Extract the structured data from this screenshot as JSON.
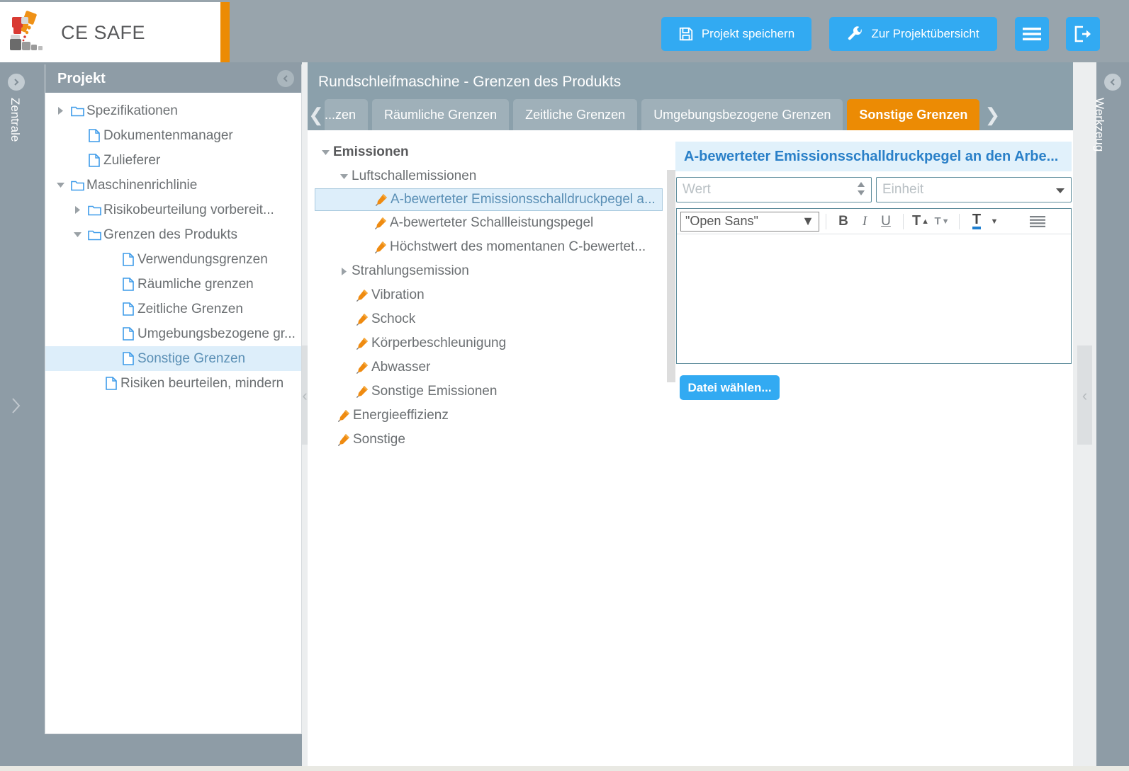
{
  "brand": {
    "name": "CE SAFE",
    "accent": "#ec8b04",
    "blue": "#32aaf2"
  },
  "topbar": {
    "save_label": "Projekt speichern",
    "overview_label": "Zur Projektübersicht",
    "menu_label": "",
    "logout_label": ""
  },
  "left_rail": {
    "label": "Zentrale",
    "icon": "chevron-right-circle-icon"
  },
  "right_rail": {
    "label": "Werkzeug",
    "icon": "chevron-left-circle-icon"
  },
  "project_panel": {
    "title": "Projekt",
    "collapse_icon": "chevron-left-circle-icon",
    "tree": [
      {
        "label": "Spezifikationen",
        "icon": "folder-icon",
        "twisty": "collapsed",
        "indent": 0,
        "selected": false
      },
      {
        "label": "Dokumentenmanager",
        "icon": "file-icon",
        "twisty": "none",
        "indent": 1,
        "selected": false
      },
      {
        "label": "Zulieferer",
        "icon": "file-icon",
        "twisty": "none",
        "indent": 1,
        "selected": false
      },
      {
        "label": "Maschinenrichlinie",
        "icon": "folder-icon",
        "twisty": "expanded",
        "indent": 0,
        "selected": false
      },
      {
        "label": "Risikobeurteilung vorbereit...",
        "icon": "folder-icon",
        "twisty": "collapsed",
        "indent": 1,
        "selected": false
      },
      {
        "label": "Grenzen des Produkts",
        "icon": "folder-icon",
        "twisty": "expanded",
        "indent": 1,
        "selected": false
      },
      {
        "label": "Verwendungsgrenzen",
        "icon": "file-icon",
        "twisty": "none",
        "indent": 3,
        "selected": false
      },
      {
        "label": "Räumliche grenzen",
        "icon": "file-icon",
        "twisty": "none",
        "indent": 3,
        "selected": false
      },
      {
        "label": "Zeitliche Grenzen",
        "icon": "file-icon",
        "twisty": "none",
        "indent": 3,
        "selected": false
      },
      {
        "label": "Umgebungsbezogene gr...",
        "icon": "file-icon",
        "twisty": "none",
        "indent": 3,
        "selected": false
      },
      {
        "label": "Sonstige Grenzen",
        "icon": "file-icon",
        "twisty": "none",
        "indent": 3,
        "selected": true
      },
      {
        "label": "Risiken beurteilen, mindern",
        "icon": "file-icon",
        "twisty": "none",
        "indent": 2,
        "selected": false
      }
    ]
  },
  "content": {
    "title": "Rundschleifmaschine - Grenzen des Produkts",
    "prev_arrow": "chevron-left-icon",
    "next_arrow": "chevron-right-icon",
    "tabs": [
      {
        "label": "...zen",
        "active": false,
        "clipped": true
      },
      {
        "label": "Räumliche Grenzen",
        "active": false,
        "clipped": false
      },
      {
        "label": "Zeitliche Grenzen",
        "active": false,
        "clipped": false
      },
      {
        "label": "Umgebungsbezogene Grenzen",
        "active": false,
        "clipped": false
      },
      {
        "label": "Sonstige Grenzen",
        "active": true,
        "clipped": false
      }
    ]
  },
  "emissions_tree": [
    {
      "label": "Emissionen",
      "twisty": "expanded",
      "icon": "none",
      "indent": 0,
      "root": true,
      "selected": false
    },
    {
      "label": "Luftschallemissionen",
      "twisty": "expanded",
      "icon": "none",
      "indent": 1,
      "root": false,
      "selected": false
    },
    {
      "label": "A-bewerteter Emissionsschalldruckpegel a...",
      "twisty": "none",
      "icon": "pencil-icon",
      "indent": 2,
      "root": false,
      "selected": true
    },
    {
      "label": "A-bewerteter Schallleistungspegel",
      "twisty": "none",
      "icon": "pencil-icon",
      "indent": 2,
      "root": false,
      "selected": false
    },
    {
      "label": "Höchstwert des momentanen C-bewertet...",
      "twisty": "none",
      "icon": "pencil-icon",
      "indent": 2,
      "root": false,
      "selected": false
    },
    {
      "label": "Strahlungsemission",
      "twisty": "collapsed",
      "icon": "none",
      "indent": 1,
      "root": false,
      "selected": false
    },
    {
      "label": "Vibration",
      "twisty": "none",
      "icon": "pencil-icon",
      "indent": 1,
      "root": false,
      "selected": false
    },
    {
      "label": "Schock",
      "twisty": "none",
      "icon": "pencil-icon",
      "indent": 1,
      "root": false,
      "selected": false
    },
    {
      "label": "Körperbeschleunigung",
      "twisty": "none",
      "icon": "pencil-icon",
      "indent": 1,
      "root": false,
      "selected": false
    },
    {
      "label": "Abwasser",
      "twisty": "none",
      "icon": "pencil-icon",
      "indent": 1,
      "root": false,
      "selected": false
    },
    {
      "label": "Sonstige Emissionen",
      "twisty": "none",
      "icon": "pencil-icon",
      "indent": 1,
      "root": false,
      "selected": false
    },
    {
      "label": "Energieeffizienz",
      "twisty": "none",
      "icon": "pencil-icon",
      "indent": 0,
      "root": false,
      "selected": false
    },
    {
      "label": "Sonstige",
      "twisty": "none",
      "icon": "pencil-icon",
      "indent": 0,
      "root": false,
      "selected": false
    }
  ],
  "detail": {
    "title": "A-bewerteter Emissionsschalldruckpegel an den Arbe...",
    "value_placeholder": "Wert",
    "value": "",
    "unit_placeholder": "Einheit",
    "unit": "",
    "font_value": "\"Open Sans\"",
    "editor_text": "",
    "file_button_label": "Datei wählen...",
    "toolbar": [
      {
        "name": "bold-icon",
        "glyph": "B"
      },
      {
        "name": "italic-icon",
        "glyph": "I"
      },
      {
        "name": "underline-icon",
        "glyph": "U"
      },
      {
        "name": "increase-font-size-icon",
        "glyph": "T"
      },
      {
        "name": "decrease-font-size-icon",
        "glyph": "T"
      },
      {
        "name": "text-color-icon",
        "glyph": "T"
      },
      {
        "name": "align-icon",
        "glyph": "≡"
      }
    ]
  }
}
